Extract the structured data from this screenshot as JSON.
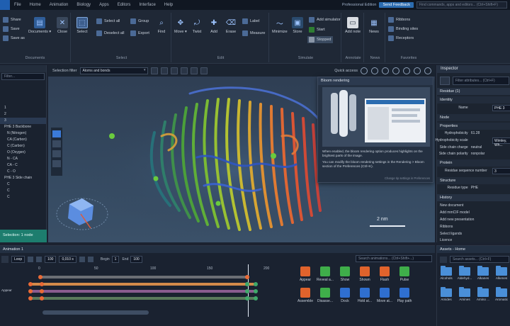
{
  "menu": {
    "items": [
      "File",
      "Home",
      "Animation",
      "Biology",
      "Apps",
      "Editors",
      "Interface",
      "Help"
    ],
    "edition": "Professional Edition",
    "feedback": "Send Feedback",
    "command_placeholder": "Find commands, apps and editors... (Ctrl+Shift+F)"
  },
  "ribbon": {
    "documents": {
      "share": "Share",
      "save": "Save",
      "save_as": "Save as",
      "documents": "Documents ▾",
      "close": "Close",
      "label": "Documents"
    },
    "select": {
      "select": "Select",
      "select_all": "Select all",
      "deselect_all": "Deselect all",
      "group": "Group",
      "export": "Export",
      "find": "Find",
      "label": "Select"
    },
    "edit": {
      "move": "Move ▾",
      "twist": "Twist",
      "add": "Add",
      "erase": "Erase",
      "label_btn": "Label",
      "measure": "Measure",
      "label": "Edit"
    },
    "simulate": {
      "minimize": "Minimize",
      "store": "Store",
      "add_simulator": "Add simulator",
      "start": "Start",
      "stopped": "Stopped",
      "label": "Simulate"
    },
    "annotate": {
      "add_note": "Add note",
      "label": "Annotate"
    },
    "news": {
      "news": "News",
      "label": "News"
    },
    "favorites": {
      "ribbons": "Ribbons",
      "binding_sites": "Binding sites",
      "receptors": "Receptors",
      "label": "Favorites"
    }
  },
  "left_panel": {
    "filter_placeholder": "Filter...",
    "items": [
      "1",
      "2",
      "3",
      "PHE 3 Backbone",
      "N (Nitrogen)",
      "CA (Carbon)",
      "C (Carbon)",
      "O (Oxygen)",
      "N - CA",
      "CA - C",
      "C - O",
      "PHE 3 Side chain",
      "C",
      "C",
      "C"
    ],
    "footer": "Selection: 1 node"
  },
  "viewport": {
    "selection_filter_label": "Selection filter",
    "selection_filter_value": "Atoms and bonds",
    "quick_access_label": "Quick access",
    "scale_label": "2 nm",
    "tooltip": {
      "title": "Bloom rendering",
      "text1": "When enabled, the bloom rendering option produces highlights on the brightest parts of the image.",
      "text2": "You can modify the bloom rendering settings in the Rendering > Bloom section of the Preferences (Ctrl+K).",
      "hint": "Change tip settings in Preferences"
    }
  },
  "inspector": {
    "title": "Inspector",
    "filter_placeholder": "Filter attributes... (Ctrl+F)",
    "node_title": "Residue (1)",
    "sections": {
      "identity": "Identity",
      "node": "Node",
      "properties": "Properties",
      "protein": "Protein",
      "structure": "Structure"
    },
    "name_label": "Name",
    "name_value": "PHE 3",
    "hydrophobicity_label": "Hydrophobicity",
    "hydrophobicity_value": "61.28",
    "scale_label": "Hydrophobicity scale",
    "scale_value": "Wimley, Wh...",
    "charge_label": "Side chain charge",
    "charge_value": "neutral",
    "polarity_label": "Side chain polarity",
    "polarity_value": "nonpolar",
    "seq_label": "Residue sequence number",
    "seq_value": "3",
    "type_label": "Residue type",
    "type_value": "PHE",
    "history_title": "History",
    "history": [
      "New document",
      "Add mmCIF model",
      "Add new presentation",
      "Ribbons",
      "Select ligands",
      "Licence"
    ]
  },
  "animation": {
    "title": "Animation 1",
    "loop": "Loop",
    "fps": "100",
    "time": "0,010 s",
    "begin_label": "Begin",
    "begin": "1",
    "end_label": "End",
    "end": "100",
    "ticks": [
      "0",
      "50",
      "100",
      "150",
      "200"
    ],
    "tracks": [
      "",
      "Appear",
      ""
    ],
    "effects_search": "Search animations... (Ctrl+Shift+...)",
    "effects": [
      "Appear",
      "Reveal a...",
      "Show",
      "Shown",
      "Flash",
      "Pulse",
      "Assemble",
      "Disasse...",
      "Dock",
      "Hold at...",
      "Move at...",
      "Play path"
    ]
  },
  "assets": {
    "title": "Assets - Home",
    "search": "Search assets... (Ctrl+F)",
    "folders": [
      "Alcohols",
      "Aldehyd...",
      "Alkanes",
      "Alkenes",
      "Amides",
      "Amines",
      "Amino ...",
      "Aromatic"
    ]
  }
}
